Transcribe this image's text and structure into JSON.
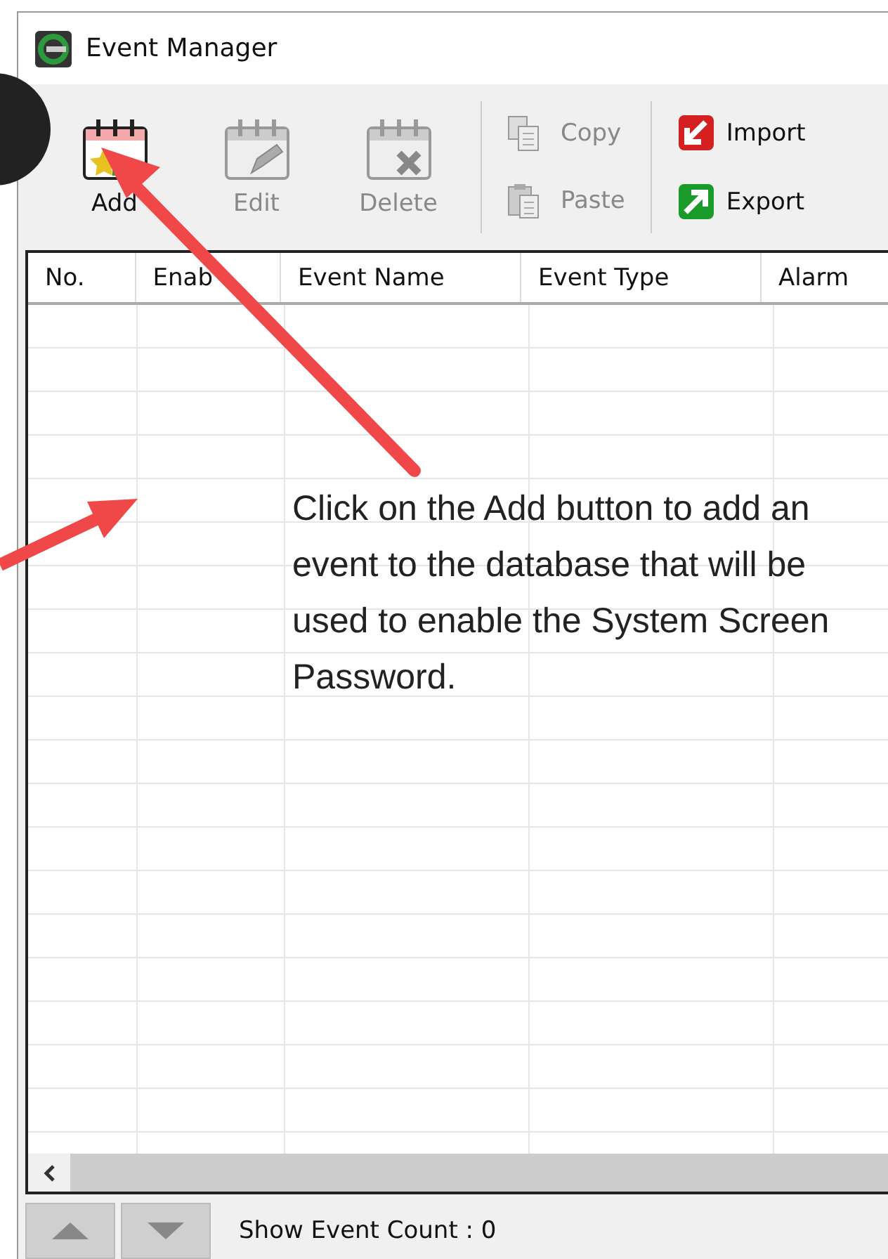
{
  "window": {
    "title": "Event Manager"
  },
  "toolbar": {
    "event_buttons": [
      {
        "label": "Add",
        "kind": "add",
        "disabled": false
      },
      {
        "label": "Edit",
        "kind": "edit",
        "disabled": true
      },
      {
        "label": "Delete",
        "kind": "delete",
        "disabled": true
      }
    ],
    "clipboard_buttons": [
      {
        "label": "Copy",
        "kind": "copy",
        "disabled": true
      },
      {
        "label": "Paste",
        "kind": "paste",
        "disabled": true
      }
    ],
    "file_buttons": [
      {
        "label": "Import",
        "kind": "import",
        "disabled": false
      },
      {
        "label": "Export",
        "kind": "export",
        "disabled": false
      }
    ]
  },
  "table": {
    "columns": [
      "No.",
      "Enab",
      "Event Name",
      "Event Type",
      "Alarm"
    ]
  },
  "status_bar": {
    "count_label": "Show Event Count : 0"
  },
  "annotation": {
    "text": "Click on the Add button to add an event to the database that will be used to enable the System Screen Password."
  }
}
